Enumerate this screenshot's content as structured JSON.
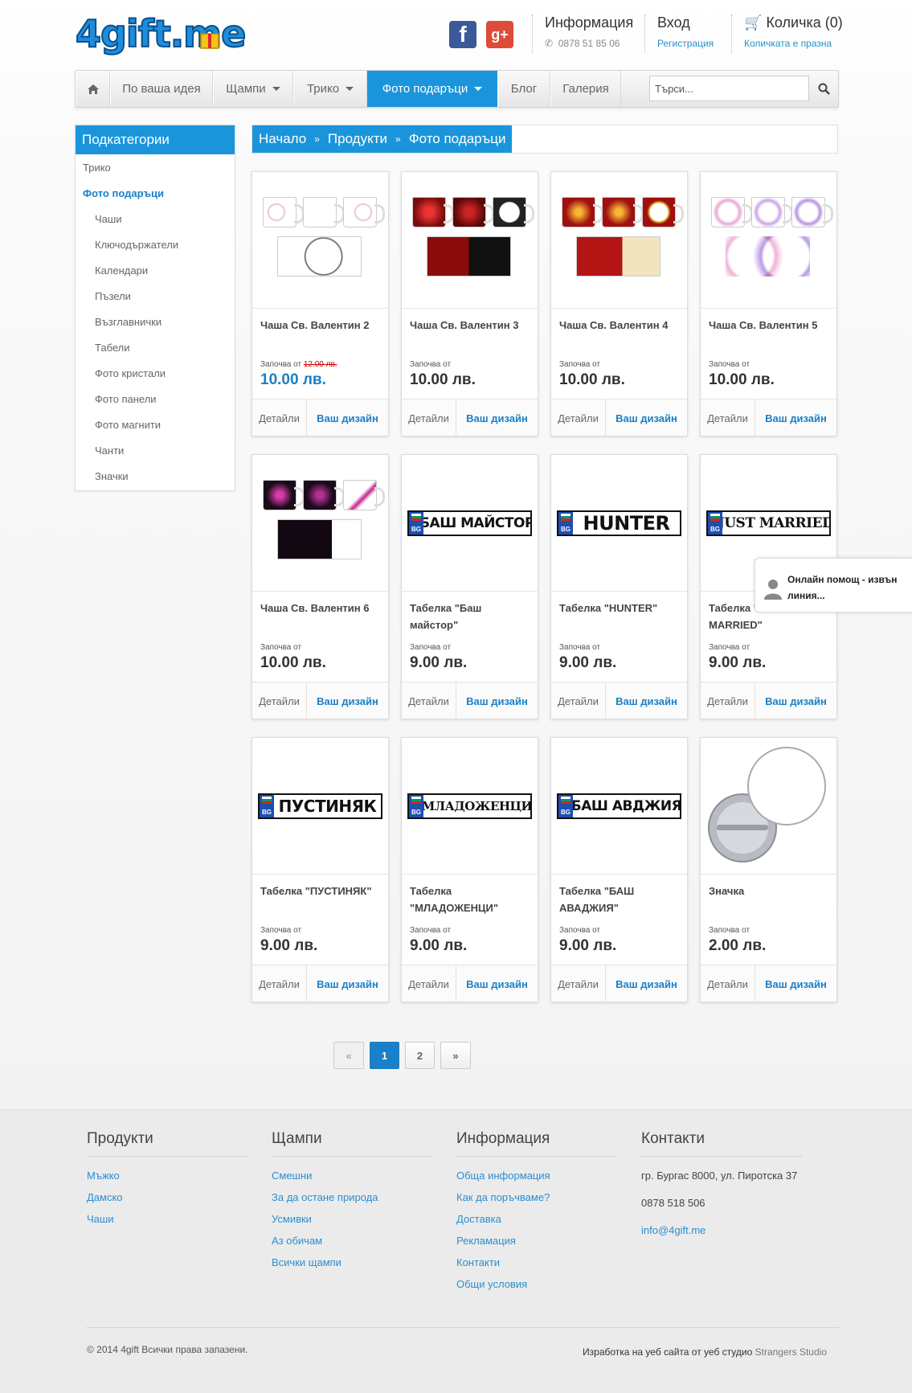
{
  "header": {
    "logo_text": "4gift.me",
    "info": {
      "title": "Информация",
      "phone": "0878 51 85 06"
    },
    "login": {
      "title": "Вход",
      "register": "Регистрация"
    },
    "cart": {
      "title": "Количка (0)",
      "status": "Количката е празна"
    }
  },
  "nav": {
    "items": [
      {
        "label": "По ваша идея"
      },
      {
        "label": "Щампи"
      },
      {
        "label": "Трико"
      },
      {
        "label": "Фото подаръци"
      },
      {
        "label": "Блог"
      },
      {
        "label": "Галерия"
      }
    ],
    "search_placeholder": "Търси...",
    "active_color": "#1a95dc"
  },
  "sidebar": {
    "title": "Подкатегории",
    "items": [
      {
        "label": "Трико"
      },
      {
        "label": "Фото подаръци"
      },
      {
        "label": "Чаши"
      },
      {
        "label": "Ключодържатели"
      },
      {
        "label": "Календари"
      },
      {
        "label": "Пъзели"
      },
      {
        "label": "Възглавнички"
      },
      {
        "label": "Табели"
      },
      {
        "label": "Фото кристали"
      },
      {
        "label": "Фото панели"
      },
      {
        "label": "Фото магнити"
      },
      {
        "label": "Чанти"
      },
      {
        "label": "Значки"
      }
    ]
  },
  "breadcrumb": {
    "items": [
      "Начало",
      "Продукти",
      "Фото подаръци"
    ],
    "sep": "»"
  },
  "products": [
    {
      "name": "Чаша Св. Валентин 2",
      "from": "Започва от",
      "old_price": "12.00 лв.",
      "price": "10.00 лв.",
      "details": "Детайли",
      "design": "Ваш дизайн"
    },
    {
      "name": "Чаша Св. Валентин 3",
      "from": "Започва от",
      "price": "10.00 лв.",
      "details": "Детайли",
      "design": "Ваш дизайн"
    },
    {
      "name": "Чаша Св. Валентин 4",
      "from": "Започва от",
      "price": "10.00 лв.",
      "details": "Детайли",
      "design": "Ваш дизайн"
    },
    {
      "name": "Чаша Св. Валентин 5",
      "from": "Започва от",
      "price": "10.00 лв.",
      "details": "Детайли",
      "design": "Ваш дизайн"
    },
    {
      "name": "Чаша Св. Валентин 6",
      "from": "Започва от",
      "price": "10.00 лв.",
      "details": "Детайли",
      "design": "Ваш дизайн"
    },
    {
      "name": "Табелка \"Баш майстор\"",
      "from": "Започва от",
      "price": "9.00 лв.",
      "details": "Детайли",
      "design": "Ваш дизайн",
      "plate": "БАШ МАЙСТОР"
    },
    {
      "name": "Табелка \"HUNTER\"",
      "from": "Започва от",
      "price": "9.00 лв.",
      "details": "Детайли",
      "design": "Ваш дизайн",
      "plate": "HUNTER"
    },
    {
      "name": "Табелка \"JUST MARRIED\"",
      "from": "Започва от",
      "price": "9.00 лв.",
      "details": "Детайли",
      "design": "Ваш дизайн",
      "plate": "JUST MARRIED"
    },
    {
      "name": "Табелка \"ПУСТИНЯК\"",
      "from": "Започва от",
      "price": "9.00 лв.",
      "details": "Детайли",
      "design": "Ваш дизайн",
      "plate": "ПУСТИНЯК"
    },
    {
      "name": "Табелка \"МЛАДОЖЕНЦИ\"",
      "from": "Започва от",
      "price": "9.00 лв.",
      "details": "Детайли",
      "design": "Ваш дизайн",
      "plate": "МЛАДОЖЕНЦИ"
    },
    {
      "name": "Табелка \"БАШ АВАДЖИЯ\"",
      "from": "Започва от",
      "price": "9.00 лв.",
      "details": "Детайли",
      "design": "Ваш дизайн",
      "plate": "БАШ АВДЖИЯ"
    },
    {
      "name": "Значка",
      "from": "Започва от",
      "price": "2.00 лв.",
      "details": "Детайли",
      "design": "Ваш дизайн"
    }
  ],
  "chat": {
    "text": "Онлайн помощ - извън линия..."
  },
  "pagination": {
    "prev": "«",
    "pages": [
      "1",
      "2"
    ],
    "next": "»"
  },
  "footer": {
    "products": {
      "title": "Продукти",
      "links": [
        "Мъжко",
        "Дамско",
        "Чаши"
      ]
    },
    "prints": {
      "title": "Щампи",
      "links": [
        "Смешни",
        "За да остане природа",
        "Усмивки",
        "Аз обичам",
        "Всички щампи"
      ]
    },
    "info": {
      "title": "Информация",
      "links": [
        "Обща информация",
        "Как да поръчваме?",
        "Доставка",
        "Рекламация",
        "Контакти",
        "Общи условия"
      ]
    },
    "contacts": {
      "title": "Контакти",
      "address": "гр. Бургас 8000, ул. Пиротска 37",
      "phone": "0878 518 506",
      "email": "info@4gift.me"
    },
    "copyright": "© 2014 4gift Всички права запазени.",
    "credit_a": "Изработка на уеб сайта",
    "credit_b": "от уеб студио",
    "credit_c": "Strangers Studio"
  }
}
